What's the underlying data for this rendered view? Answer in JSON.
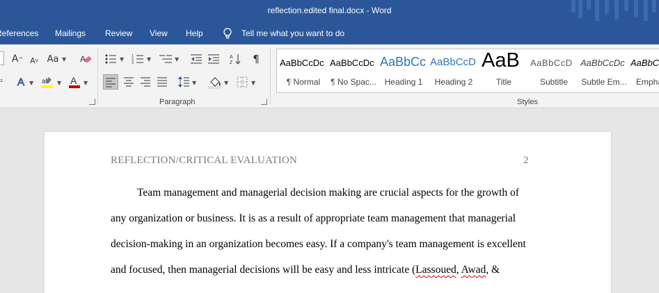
{
  "window": {
    "title": "reflection.edited  final.docx  -  Word"
  },
  "tabs": {
    "references": "References",
    "mailings": "Mailings",
    "review": "Review",
    "view": "View",
    "help": "Help",
    "tell_me": "Tell me what you want to do"
  },
  "ribbon": {
    "font": {
      "change_case_label": "Aa"
    },
    "paragraph": {
      "group_label": "Paragraph"
    },
    "styles": {
      "group_label": "Styles",
      "items": [
        {
          "sample": "AaBbCcDc",
          "label": "¶ Normal"
        },
        {
          "sample": "AaBbCcDc",
          "label": "¶ No Spac..."
        },
        {
          "sample": "AaBbCc",
          "label": "Heading 1"
        },
        {
          "sample": "AaBbCcD",
          "label": "Heading 2"
        },
        {
          "sample": "AaB",
          "label": "Title"
        },
        {
          "sample": "AaBbCcD",
          "label": "Subtitle"
        },
        {
          "sample": "AaBbCcDc",
          "label": "Subtle Em..."
        },
        {
          "sample": "AaBbCc",
          "label": "Empha"
        }
      ]
    },
    "colors": {
      "highlight": "#ffff00",
      "font_color": "#c00000",
      "accent": "#2b579a"
    }
  },
  "document": {
    "header": "REFLECTION/CRITICAL EVALUATION",
    "page_number": "2",
    "lines": [
      "Team management and managerial decision making are crucial aspects for the growth of",
      "any organization or business. It is as a result of appropriate team management that managerial",
      "decision-making in an organization becomes easy. If a company's team management is excellent"
    ],
    "line4_before": "and focused, then managerial decisions will be easy and less intricate (",
    "line4_name1": "Lassoued",
    "line4_sep": ", ",
    "line4_name2": "Awad",
    "line4_after": ", &"
  }
}
